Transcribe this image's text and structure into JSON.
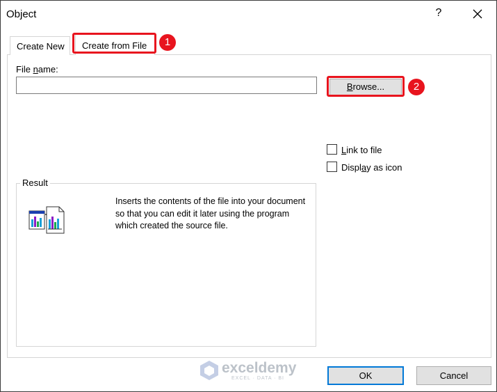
{
  "window": {
    "title": "Object",
    "help_label": "?"
  },
  "tabs": [
    {
      "label": "Create New"
    },
    {
      "label": "Create from File"
    }
  ],
  "file_name": {
    "label_pre": "File ",
    "label_accel": "n",
    "label_post": "ame:",
    "value": "",
    "placeholder": ""
  },
  "browse": {
    "label_accel": "B",
    "label_post": "rowse..."
  },
  "options": {
    "link_accel": "L",
    "link_post": "ink to file",
    "link_checked": false,
    "display_pre": "Displ",
    "display_accel": "a",
    "display_post": "y as icon",
    "display_checked": false
  },
  "result": {
    "legend": "Result",
    "description": "Inserts the contents of the file into your document so that you can edit it later using the program which created the source file.",
    "icon": "embedded-document-icon"
  },
  "buttons": {
    "ok": "OK",
    "cancel": "Cancel"
  },
  "annotations": {
    "step1": "1",
    "step2": "2",
    "color": "#e8141e"
  },
  "watermark": {
    "name": "exceldemy",
    "tagline": "EXCEL · DATA · BI"
  }
}
